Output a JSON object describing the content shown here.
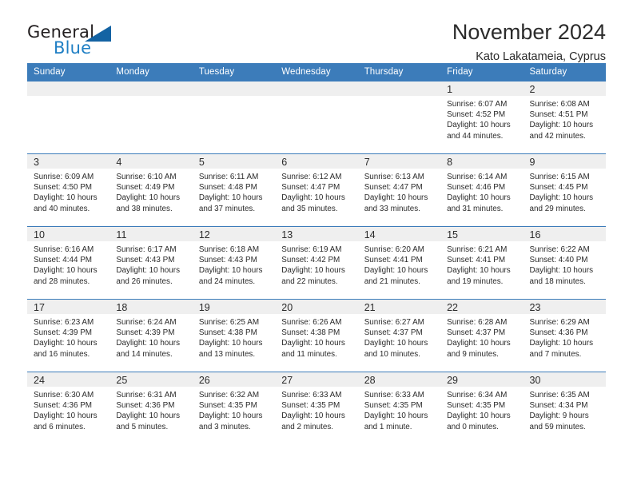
{
  "brand": {
    "name_part1": "General",
    "name_part2": "Blue",
    "accent_color": "#1463a3"
  },
  "header": {
    "title": "November 2024",
    "location": "Kato Lakatameia, Cyprus"
  },
  "calendar": {
    "header_bg": "#3c7cba",
    "daynum_bg": "#efefef",
    "weekday_headers": [
      "Sunday",
      "Monday",
      "Tuesday",
      "Wednesday",
      "Thursday",
      "Friday",
      "Saturday"
    ],
    "weeks": [
      [
        {
          "day": ""
        },
        {
          "day": ""
        },
        {
          "day": ""
        },
        {
          "day": ""
        },
        {
          "day": ""
        },
        {
          "day": "1",
          "sunrise": "Sunrise: 6:07 AM",
          "sunset": "Sunset: 4:52 PM",
          "daylight_line1": "Daylight: 10 hours",
          "daylight_line2": "and 44 minutes."
        },
        {
          "day": "2",
          "sunrise": "Sunrise: 6:08 AM",
          "sunset": "Sunset: 4:51 PM",
          "daylight_line1": "Daylight: 10 hours",
          "daylight_line2": "and 42 minutes."
        }
      ],
      [
        {
          "day": "3",
          "sunrise": "Sunrise: 6:09 AM",
          "sunset": "Sunset: 4:50 PM",
          "daylight_line1": "Daylight: 10 hours",
          "daylight_line2": "and 40 minutes."
        },
        {
          "day": "4",
          "sunrise": "Sunrise: 6:10 AM",
          "sunset": "Sunset: 4:49 PM",
          "daylight_line1": "Daylight: 10 hours",
          "daylight_line2": "and 38 minutes."
        },
        {
          "day": "5",
          "sunrise": "Sunrise: 6:11 AM",
          "sunset": "Sunset: 4:48 PM",
          "daylight_line1": "Daylight: 10 hours",
          "daylight_line2": "and 37 minutes."
        },
        {
          "day": "6",
          "sunrise": "Sunrise: 6:12 AM",
          "sunset": "Sunset: 4:47 PM",
          "daylight_line1": "Daylight: 10 hours",
          "daylight_line2": "and 35 minutes."
        },
        {
          "day": "7",
          "sunrise": "Sunrise: 6:13 AM",
          "sunset": "Sunset: 4:47 PM",
          "daylight_line1": "Daylight: 10 hours",
          "daylight_line2": "and 33 minutes."
        },
        {
          "day": "8",
          "sunrise": "Sunrise: 6:14 AM",
          "sunset": "Sunset: 4:46 PM",
          "daylight_line1": "Daylight: 10 hours",
          "daylight_line2": "and 31 minutes."
        },
        {
          "day": "9",
          "sunrise": "Sunrise: 6:15 AM",
          "sunset": "Sunset: 4:45 PM",
          "daylight_line1": "Daylight: 10 hours",
          "daylight_line2": "and 29 minutes."
        }
      ],
      [
        {
          "day": "10",
          "sunrise": "Sunrise: 6:16 AM",
          "sunset": "Sunset: 4:44 PM",
          "daylight_line1": "Daylight: 10 hours",
          "daylight_line2": "and 28 minutes."
        },
        {
          "day": "11",
          "sunrise": "Sunrise: 6:17 AM",
          "sunset": "Sunset: 4:43 PM",
          "daylight_line1": "Daylight: 10 hours",
          "daylight_line2": "and 26 minutes."
        },
        {
          "day": "12",
          "sunrise": "Sunrise: 6:18 AM",
          "sunset": "Sunset: 4:43 PM",
          "daylight_line1": "Daylight: 10 hours",
          "daylight_line2": "and 24 minutes."
        },
        {
          "day": "13",
          "sunrise": "Sunrise: 6:19 AM",
          "sunset": "Sunset: 4:42 PM",
          "daylight_line1": "Daylight: 10 hours",
          "daylight_line2": "and 22 minutes."
        },
        {
          "day": "14",
          "sunrise": "Sunrise: 6:20 AM",
          "sunset": "Sunset: 4:41 PM",
          "daylight_line1": "Daylight: 10 hours",
          "daylight_line2": "and 21 minutes."
        },
        {
          "day": "15",
          "sunrise": "Sunrise: 6:21 AM",
          "sunset": "Sunset: 4:41 PM",
          "daylight_line1": "Daylight: 10 hours",
          "daylight_line2": "and 19 minutes."
        },
        {
          "day": "16",
          "sunrise": "Sunrise: 6:22 AM",
          "sunset": "Sunset: 4:40 PM",
          "daylight_line1": "Daylight: 10 hours",
          "daylight_line2": "and 18 minutes."
        }
      ],
      [
        {
          "day": "17",
          "sunrise": "Sunrise: 6:23 AM",
          "sunset": "Sunset: 4:39 PM",
          "daylight_line1": "Daylight: 10 hours",
          "daylight_line2": "and 16 minutes."
        },
        {
          "day": "18",
          "sunrise": "Sunrise: 6:24 AM",
          "sunset": "Sunset: 4:39 PM",
          "daylight_line1": "Daylight: 10 hours",
          "daylight_line2": "and 14 minutes."
        },
        {
          "day": "19",
          "sunrise": "Sunrise: 6:25 AM",
          "sunset": "Sunset: 4:38 PM",
          "daylight_line1": "Daylight: 10 hours",
          "daylight_line2": "and 13 minutes."
        },
        {
          "day": "20",
          "sunrise": "Sunrise: 6:26 AM",
          "sunset": "Sunset: 4:38 PM",
          "daylight_line1": "Daylight: 10 hours",
          "daylight_line2": "and 11 minutes."
        },
        {
          "day": "21",
          "sunrise": "Sunrise: 6:27 AM",
          "sunset": "Sunset: 4:37 PM",
          "daylight_line1": "Daylight: 10 hours",
          "daylight_line2": "and 10 minutes."
        },
        {
          "day": "22",
          "sunrise": "Sunrise: 6:28 AM",
          "sunset": "Sunset: 4:37 PM",
          "daylight_line1": "Daylight: 10 hours",
          "daylight_line2": "and 9 minutes."
        },
        {
          "day": "23",
          "sunrise": "Sunrise: 6:29 AM",
          "sunset": "Sunset: 4:36 PM",
          "daylight_line1": "Daylight: 10 hours",
          "daylight_line2": "and 7 minutes."
        }
      ],
      [
        {
          "day": "24",
          "sunrise": "Sunrise: 6:30 AM",
          "sunset": "Sunset: 4:36 PM",
          "daylight_line1": "Daylight: 10 hours",
          "daylight_line2": "and 6 minutes."
        },
        {
          "day": "25",
          "sunrise": "Sunrise: 6:31 AM",
          "sunset": "Sunset: 4:36 PM",
          "daylight_line1": "Daylight: 10 hours",
          "daylight_line2": "and 5 minutes."
        },
        {
          "day": "26",
          "sunrise": "Sunrise: 6:32 AM",
          "sunset": "Sunset: 4:35 PM",
          "daylight_line1": "Daylight: 10 hours",
          "daylight_line2": "and 3 minutes."
        },
        {
          "day": "27",
          "sunrise": "Sunrise: 6:33 AM",
          "sunset": "Sunset: 4:35 PM",
          "daylight_line1": "Daylight: 10 hours",
          "daylight_line2": "and 2 minutes."
        },
        {
          "day": "28",
          "sunrise": "Sunrise: 6:33 AM",
          "sunset": "Sunset: 4:35 PM",
          "daylight_line1": "Daylight: 10 hours",
          "daylight_line2": "and 1 minute."
        },
        {
          "day": "29",
          "sunrise": "Sunrise: 6:34 AM",
          "sunset": "Sunset: 4:35 PM",
          "daylight_line1": "Daylight: 10 hours",
          "daylight_line2": "and 0 minutes."
        },
        {
          "day": "30",
          "sunrise": "Sunrise: 6:35 AM",
          "sunset": "Sunset: 4:34 PM",
          "daylight_line1": "Daylight: 9 hours",
          "daylight_line2": "and 59 minutes."
        }
      ]
    ]
  }
}
